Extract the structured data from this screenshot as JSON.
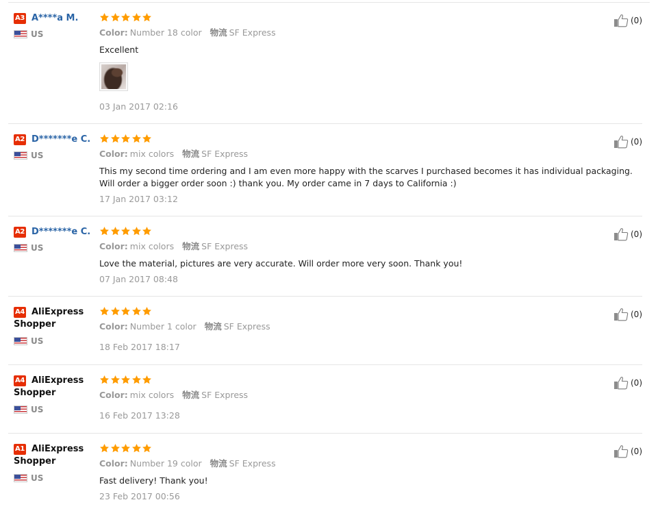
{
  "colors": {
    "badge": "#e62e04",
    "star": "#ff9c00",
    "link_name": "#2a64a6",
    "muted": "#999999"
  },
  "icons": {
    "rating": "star-icon",
    "helpful": "thumbs-up-icon",
    "country": "us-flag-icon"
  },
  "reviews": [
    {
      "level": "A3",
      "name": "A****a M.",
      "country": "US",
      "stars": 5,
      "color_label": "Color:",
      "color_value": "Number 18 color",
      "shipping_label": "物流",
      "shipping_value": "SF Express",
      "text": "Excellent",
      "has_photo": true,
      "date": "03 Jan 2017 02:16",
      "helpful_count": "(0)"
    },
    {
      "level": "A2",
      "name": "D*******e C.",
      "country": "US",
      "stars": 5,
      "color_label": "Color:",
      "color_value": "mix colors",
      "shipping_label": "物流",
      "shipping_value": "SF Express",
      "text": "This my second time ordering and I am even more happy with the scarves I purchased becomes it has individual packaging. Will order a bigger order soon :) thank you. My order came in 7 days to California :)",
      "has_photo": false,
      "date": "17 Jan 2017 03:12",
      "helpful_count": "(0)"
    },
    {
      "level": "A2",
      "name": "D*******e C.",
      "country": "US",
      "stars": 5,
      "color_label": "Color:",
      "color_value": "mix colors",
      "shipping_label": "物流",
      "shipping_value": "SF Express",
      "text": "Love the material, pictures are very accurate. Will order more very soon. Thank you!",
      "has_photo": false,
      "date": "07 Jan 2017 08:48",
      "helpful_count": "(0)"
    },
    {
      "level": "A4",
      "name": "AliExpress Shopper",
      "country": "US",
      "stars": 5,
      "color_label": "Color:",
      "color_value": "Number 1 color",
      "shipping_label": "物流",
      "shipping_value": "SF Express",
      "text": "",
      "has_photo": false,
      "date": "18 Feb 2017 18:17",
      "helpful_count": "(0)"
    },
    {
      "level": "A4",
      "name": "AliExpress Shopper",
      "country": "US",
      "stars": 5,
      "color_label": "Color:",
      "color_value": "mix colors",
      "shipping_label": "物流",
      "shipping_value": "SF Express",
      "text": "",
      "has_photo": false,
      "date": "16 Feb 2017 13:28",
      "helpful_count": "(0)"
    },
    {
      "level": "A1",
      "name": "AliExpress Shopper",
      "country": "US",
      "stars": 5,
      "color_label": "Color:",
      "color_value": "Number 19 color",
      "shipping_label": "物流",
      "shipping_value": "SF Express",
      "text": "Fast delivery! Thank you!",
      "has_photo": false,
      "date": "23 Feb 2017 00:56",
      "helpful_count": "(0)"
    }
  ]
}
